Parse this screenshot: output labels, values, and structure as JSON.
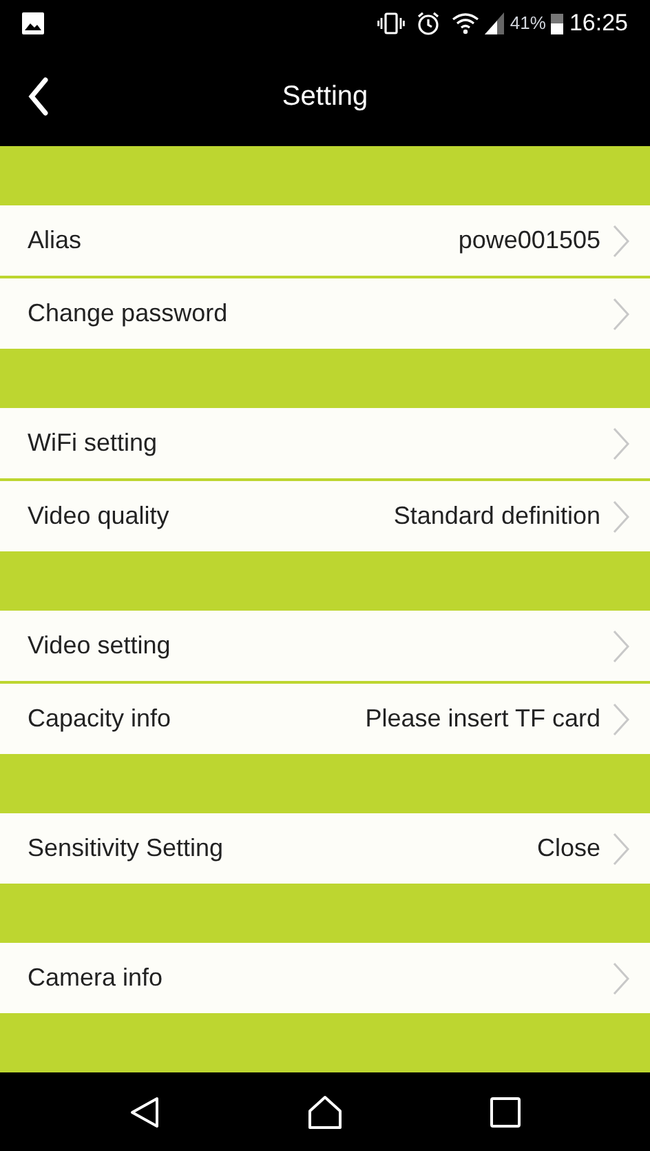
{
  "status_bar": {
    "battery": "41%",
    "time": "16:25"
  },
  "header": {
    "title": "Setting"
  },
  "groups": [
    {
      "items": [
        {
          "label": "Alias",
          "value": "powe001505"
        },
        {
          "label": "Change password"
        }
      ]
    },
    {
      "items": [
        {
          "label": "WiFi setting"
        },
        {
          "label": "Video quality",
          "value": "Standard definition"
        }
      ]
    },
    {
      "items": [
        {
          "label": "Video setting"
        },
        {
          "label": "Capacity info",
          "value": "Please insert TF card"
        }
      ]
    },
    {
      "items": [
        {
          "label": "Sensitivity Setting",
          "value": "Close"
        }
      ]
    },
    {
      "items": [
        {
          "label": "Camera info"
        }
      ]
    }
  ]
}
